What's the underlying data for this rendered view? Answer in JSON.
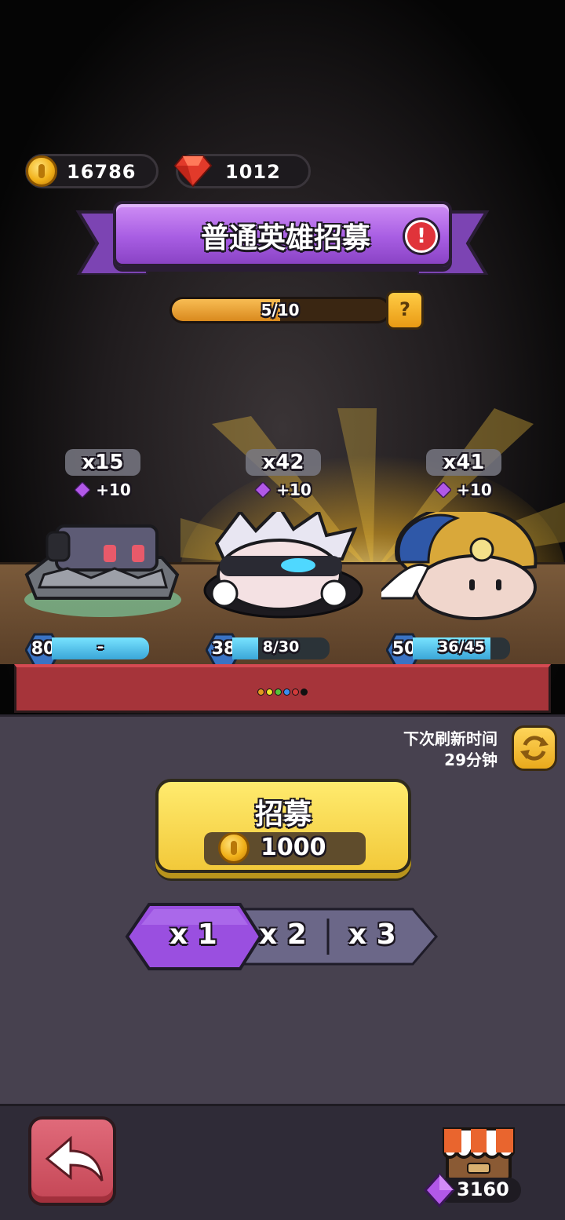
{
  "currency": {
    "coins": "16786",
    "gems": "1012"
  },
  "banner": {
    "title": "普通英雄招募",
    "alert": "!"
  },
  "progress": {
    "text": "5/10",
    "value": 0.5,
    "help": "?"
  },
  "heroes": [
    {
      "count": "x15",
      "bonus": "+10",
      "level": "80",
      "shards": "-",
      "fill": 1.0
    },
    {
      "count": "x42",
      "bonus": "+10",
      "level": "38",
      "shards": "8/30",
      "fill": 0.27
    },
    {
      "count": "x41",
      "bonus": "+10",
      "level": "50",
      "shards": "36/45",
      "fill": 0.8
    }
  ],
  "dots": [
    "#e39a1f",
    "#f0e12a",
    "#55c43a",
    "#3a8ef0",
    "#d23a3a",
    "#111111"
  ],
  "refresh": {
    "line1": "下次刷新时间",
    "line2": "29分钟"
  },
  "recruit": {
    "label": "招募",
    "cost": "1000"
  },
  "multipliers": {
    "x1": "x 1",
    "x2": "x 2",
    "x3": "x 3",
    "selected": "x1"
  },
  "shop": {
    "gems": "3160"
  },
  "colors": {
    "purple": "#a85ee3",
    "gold": "#f2c93a",
    "panel": "#47414f",
    "red_strip": "#a6343a"
  }
}
